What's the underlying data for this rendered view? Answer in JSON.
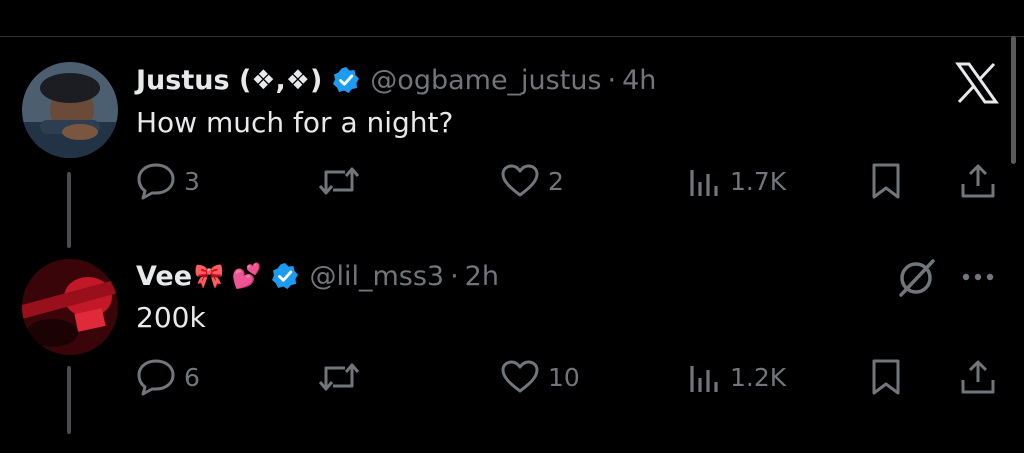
{
  "tweets": [
    {
      "name": "Justus (❖,❖)",
      "emoji": "",
      "handle": "@ogbame_justus",
      "separator": "·",
      "time": "4h",
      "text": "How much for a night?",
      "replies": "3",
      "retweets": "",
      "likes": "2",
      "views": "1.7K"
    },
    {
      "name": "Vee",
      "emoji": "🎀 💕",
      "handle": "@lil_mss3",
      "separator": "·",
      "time": "2h",
      "text": "200k",
      "replies": "6",
      "retweets": "",
      "likes": "10",
      "views": "1.2K"
    }
  ],
  "icons": {
    "brand": "x-logo-icon",
    "grok": "grok-icon",
    "more": "more-icon",
    "reply": "reply-icon",
    "retweet": "retweet-icon",
    "like": "heart-icon",
    "views": "views-icon",
    "bookmark": "bookmark-icon",
    "share": "share-icon",
    "verified": "verified-badge-icon"
  },
  "colors": {
    "background": "#000000",
    "text": "#e7e9ea",
    "muted": "#71767b",
    "verified": "#1d9bf0",
    "divider": "#2f3336"
  }
}
